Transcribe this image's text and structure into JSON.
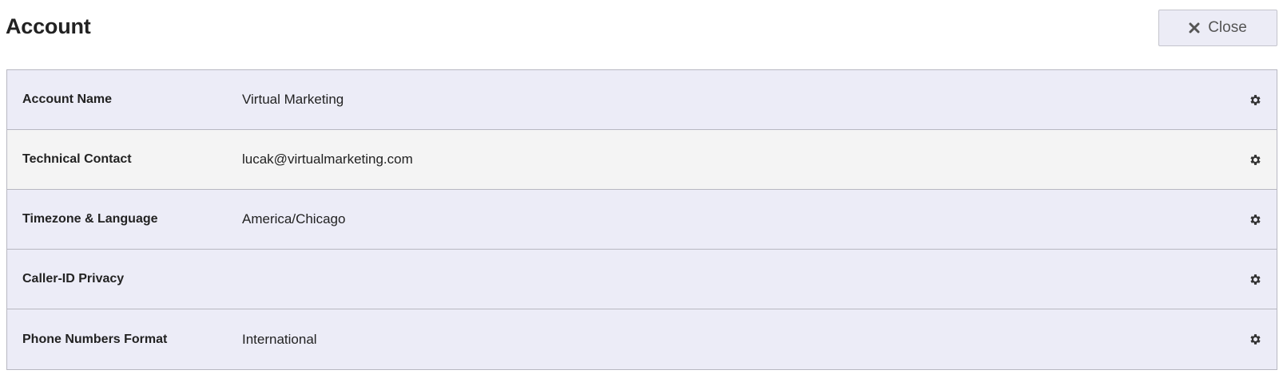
{
  "header": {
    "title": "Account",
    "close_label": "Close"
  },
  "settings": {
    "rows": [
      {
        "label": "Account Name",
        "value": "Virtual Marketing"
      },
      {
        "label": "Technical Contact",
        "value": "lucak@virtualmarketing.com"
      },
      {
        "label": "Timezone & Language",
        "value": "America/Chicago"
      },
      {
        "label": "Caller-ID Privacy",
        "value": ""
      },
      {
        "label": "Phone Numbers Format",
        "value": "International"
      }
    ]
  },
  "icons": {
    "close": "close-icon",
    "settings": "gear-icon"
  },
  "colors": {
    "row_primary": "#ececf7",
    "row_alt": "#f4f4f4",
    "border": "#b8b8c2",
    "text": "#222222"
  }
}
